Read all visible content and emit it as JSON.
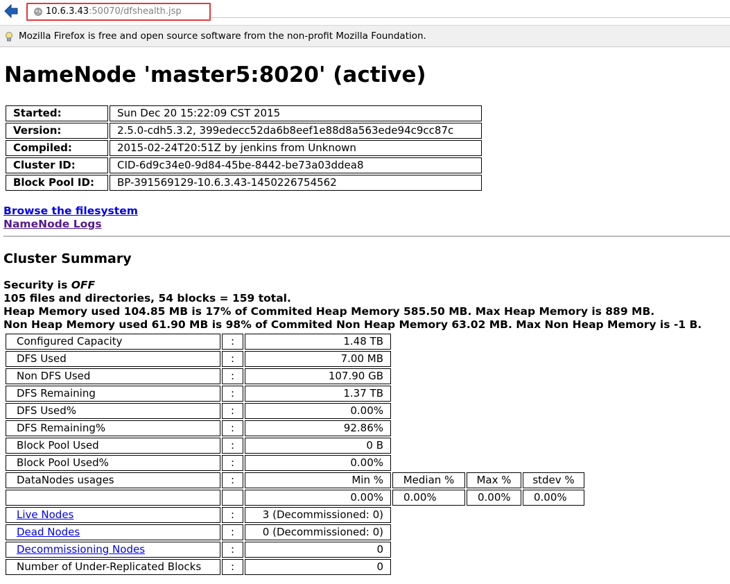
{
  "browser": {
    "url_host": "10.6.3.43",
    "url_rest": ":50070/dfshealth.jsp",
    "notice": "Mozilla Firefox is free and open source software from the non-profit Mozilla Foundation.",
    "icons": {
      "back": "back-arrow-icon",
      "site": "globe-icon",
      "notice": "lightbulb-icon"
    },
    "colors": {
      "highlight_box": "#e23a3a",
      "back_arrow": "#1e5fb4"
    }
  },
  "page": {
    "title": "NameNode 'master5:8020' (active)",
    "info": [
      {
        "key": "Started:",
        "value": "Sun Dec 20 15:22:09 CST 2015"
      },
      {
        "key": "Version:",
        "value": "2.5.0-cdh5.3.2, 399edecc52da6b8eef1e88d8a563ede94c9cc87c"
      },
      {
        "key": "Compiled:",
        "value": "2015-02-24T20:51Z by jenkins from Unknown"
      },
      {
        "key": "Cluster ID:",
        "value": "CID-6d9c34e0-9d84-45be-8442-be73a03ddea8"
      },
      {
        "key": "Block Pool ID:",
        "value": "BP-391569129-10.6.3.43-1450226754562"
      }
    ],
    "links": {
      "browse": "Browse the filesystem",
      "logs": "NameNode Logs"
    },
    "summary_heading": "Cluster Summary",
    "security_prefix": "Security is ",
    "security_value": "OFF",
    "summary_lines": [
      "105 files and directories, 54 blocks = 159 total.",
      "Heap Memory used 104.85 MB is 17% of Commited Heap Memory 585.50 MB. Max Heap Memory is 889 MB.",
      "Non Heap Memory used 61.90 MB is 98% of Commited Non Heap Memory 63.02 MB. Max Non Heap Memory is -1 B."
    ],
    "separator": ":",
    "capacity": [
      {
        "label": "Configured Capacity",
        "value": "1.48 TB"
      },
      {
        "label": "DFS Used",
        "value": "7.00 MB"
      },
      {
        "label": "Non DFS Used",
        "value": "107.90 GB"
      },
      {
        "label": "DFS Remaining",
        "value": "1.37 TB"
      },
      {
        "label": "DFS Used%",
        "value": "0.00%"
      },
      {
        "label": "DFS Remaining%",
        "value": "92.86%"
      },
      {
        "label": "Block Pool Used",
        "value": "0 B"
      },
      {
        "label": "Block Pool Used%",
        "value": "0.00%"
      }
    ],
    "datanodes": {
      "label": "DataNodes usages",
      "headers": [
        "Min %",
        "Median %",
        "Max %",
        "stdev %"
      ],
      "values": [
        "0.00%",
        "0.00%",
        "0.00%",
        "0.00%"
      ]
    },
    "nodes": [
      {
        "label": "Live Nodes",
        "value": "3 (Decommissioned: 0)",
        "link": true
      },
      {
        "label": "Dead Nodes",
        "value": "0 (Decommissioned: 0)",
        "link": true
      },
      {
        "label": "Decommissioning Nodes",
        "value": "0",
        "link": true
      },
      {
        "label": "Number of Under-Replicated Blocks",
        "value": "0",
        "link": false
      }
    ]
  }
}
